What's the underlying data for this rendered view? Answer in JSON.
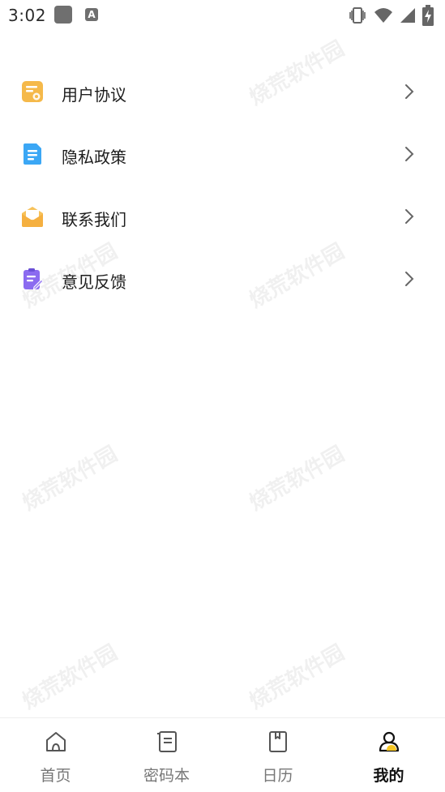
{
  "status_bar": {
    "time": "3:02",
    "app_icon_letter": "A",
    "icons": [
      "vibrate-icon",
      "wifi-icon",
      "signal-icon",
      "battery-charging-icon"
    ]
  },
  "menu": {
    "items": [
      {
        "label": "用户协议",
        "icon": "document-icon",
        "color": "#F5B94A"
      },
      {
        "label": "隐私政策",
        "icon": "file-icon",
        "color": "#3BA7F5"
      },
      {
        "label": "联系我们",
        "icon": "mail-icon",
        "color": "#F7C25A"
      },
      {
        "label": "意见反馈",
        "icon": "clipboard-edit-icon",
        "color": "#8B6BF0"
      }
    ]
  },
  "watermark": "烧荒软件园",
  "tabbar": {
    "tabs": [
      {
        "label": "首页",
        "icon": "home-icon",
        "active": false
      },
      {
        "label": "密码本",
        "icon": "notebook-icon",
        "active": false
      },
      {
        "label": "日历",
        "icon": "calendar-icon",
        "active": false
      },
      {
        "label": "我的",
        "icon": "user-icon",
        "active": true
      }
    ],
    "active_color": "#111111",
    "inactive_color": "#777777",
    "accent": "#F5C623"
  }
}
